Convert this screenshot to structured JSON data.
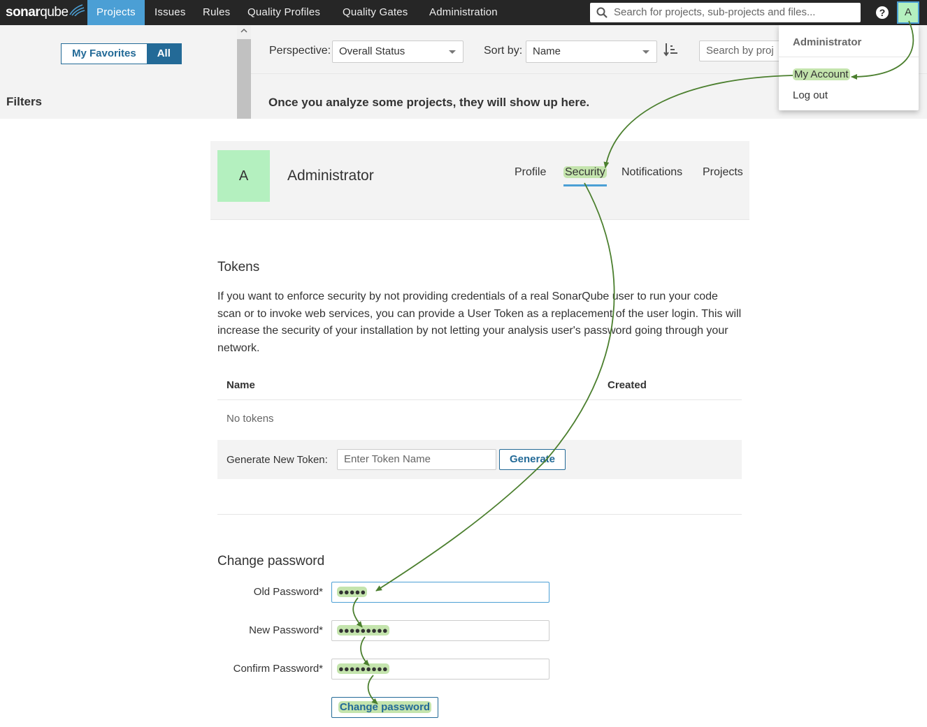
{
  "topbar": {
    "logo_text_a": "sonar",
    "logo_text_b": "qube",
    "nav": [
      "Projects",
      "Issues",
      "Rules",
      "Quality Profiles",
      "Quality Gates",
      "Administration"
    ],
    "active_nav": "Projects",
    "search_placeholder": "Search for projects, sub-projects and files...",
    "help_label": "?",
    "avatar_letter": "A"
  },
  "projects_page": {
    "favorites_label": "My Favorites",
    "all_label": "All",
    "filters_title": "Filters",
    "perspective_label": "Perspective:",
    "perspective_value": "Overall Status",
    "sort_label": "Sort by:",
    "sort_value": "Name",
    "search_placeholder": "Search by proj",
    "empty_message": "Once you analyze some projects, they will show up here."
  },
  "user_menu": {
    "title": "Administrator",
    "items": [
      "My Account",
      "Log out"
    ]
  },
  "account": {
    "avatar_letter": "A",
    "name": "Administrator",
    "tabs": [
      "Profile",
      "Security",
      "Notifications",
      "Projects"
    ],
    "active_tab": "Security"
  },
  "tokens": {
    "title": "Tokens",
    "description": "If you want to enforce security by not providing credentials of a real SonarQube user to run your code scan or to invoke web services, you can provide a User Token as a replacement of the user login. This will increase the security of your installation by not letting your analysis user's password going through your network.",
    "columns": [
      "Name",
      "Created"
    ],
    "empty": "No tokens",
    "generate_label": "Generate New Token:",
    "token_placeholder": "Enter Token Name",
    "generate_button": "Generate"
  },
  "change_password": {
    "title": "Change password",
    "old_label": "Old Password*",
    "old_value": "●●●●●",
    "new_label": "New Password*",
    "new_value": "●●●●●●●●●",
    "confirm_label": "Confirm Password*",
    "confirm_value": "●●●●●●●●●",
    "button": "Change password"
  },
  "colors": {
    "topbar": "#262626",
    "accent": "#4b9fd5",
    "primary_button": "#236a97",
    "avatar_bg": "#b4f0bf",
    "highlight": "#c4e4ad",
    "annotation_arrow": "#4b7f2e"
  }
}
